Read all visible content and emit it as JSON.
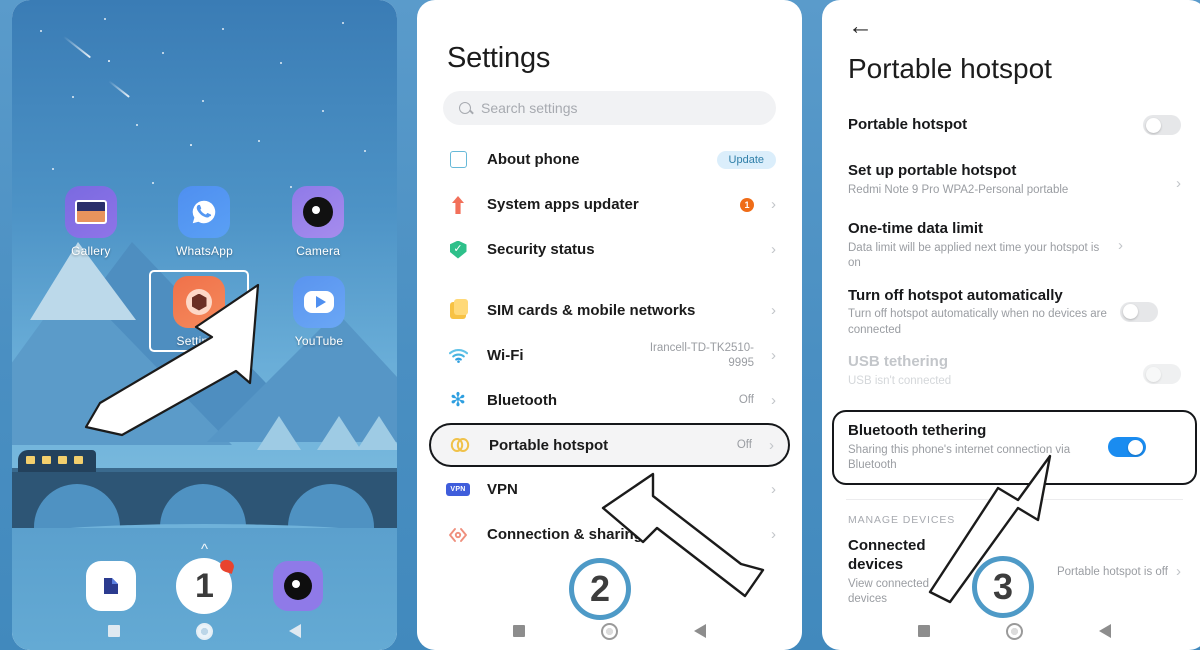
{
  "home": {
    "apps_row1": [
      {
        "label": "Gallery",
        "icon": "gallery-icon"
      },
      {
        "label": "WhatsApp",
        "icon": "whatsapp-icon"
      },
      {
        "label": "Camera",
        "icon": "camera-icon"
      }
    ],
    "apps_row2": [
      {
        "label": "Settings",
        "icon": "settings-icon",
        "selected": true
      },
      {
        "label": "YouTube",
        "icon": "youtube-icon"
      }
    ],
    "dock_badge": "1",
    "drawer_hint": "^"
  },
  "settings": {
    "title": "Settings",
    "search_placeholder": "Search settings",
    "items": [
      {
        "label": "About phone",
        "icon": "about-phone-icon",
        "badge": "Update",
        "value": "",
        "chevron": false
      },
      {
        "label": "System apps updater",
        "icon": "updater-icon",
        "dot": "1",
        "value": "",
        "chevron": true
      },
      {
        "label": "Security status",
        "icon": "security-icon",
        "value": "",
        "chevron": true
      },
      {
        "label": "SIM cards & mobile networks",
        "icon": "sim-card-icon",
        "value": "",
        "chevron": true,
        "gap": true
      },
      {
        "label": "Wi-Fi",
        "icon": "wifi-icon",
        "value": "Irancell-TD-TK2510-9995",
        "chevron": true
      },
      {
        "label": "Bluetooth",
        "icon": "bluetooth-icon",
        "value": "Off",
        "chevron": true
      },
      {
        "label": "Portable hotspot",
        "icon": "hotspot-icon",
        "value": "Off",
        "chevron": true,
        "highlight": true
      },
      {
        "label": "VPN",
        "icon": "vpn-icon",
        "value": "",
        "chevron": true
      },
      {
        "label": "Connection & sharing",
        "icon": "connection-icon",
        "value": "",
        "chevron": true
      }
    ]
  },
  "hotspot": {
    "back_icon": "back-arrow-icon",
    "title": "Portable hotspot",
    "rows": [
      {
        "title": "Portable hotspot",
        "subtitle": "",
        "control": "toggle-off"
      },
      {
        "title": "Set up portable hotspot",
        "subtitle": "Redmi Note 9 Pro WPA2-Personal portable",
        "control": "chevron"
      },
      {
        "title": "One-time data limit",
        "subtitle": "Data limit will be applied next time your hotspot is on",
        "control": "chevron"
      },
      {
        "title": "Turn off hotspot automatically",
        "subtitle": "Turn off hotspot automatically when no devices are connected",
        "control": "toggle-off"
      },
      {
        "title": "USB tethering",
        "subtitle": "USB isn't connected",
        "control": "toggle-off",
        "disabled": true
      },
      {
        "title": "Bluetooth tethering",
        "subtitle": "Sharing this phone's internet connection via Bluetooth",
        "control": "toggle-on",
        "highlight": true
      }
    ],
    "section_header": "MANAGE DEVICES",
    "connected": {
      "title": "Connected devices",
      "subtitle": "View connected devices",
      "value": "Portable hotspot is off"
    }
  },
  "steps": {
    "one": "1",
    "two": "2",
    "three": "3"
  },
  "colors": {
    "accent_blue": "#1a8cf0",
    "step_ring": "#4e9ac7",
    "backdrop": "#4a8fc2",
    "badge_orange": "#ef6c18"
  }
}
